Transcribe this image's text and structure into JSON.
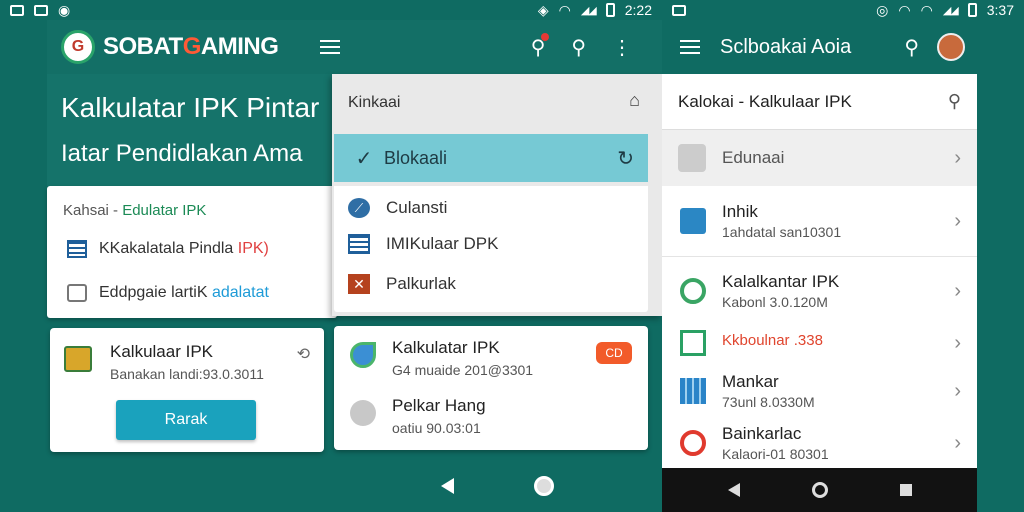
{
  "status_left": {
    "time": "2:22"
  },
  "status_right": {
    "time": "3:37"
  },
  "left_appbar": {
    "brand_prefix": "SOBAT",
    "brand_accent": "G",
    "brand_suffix": "AMING",
    "logo_glyph": "G"
  },
  "hero": {
    "title": "Kalkulatar IPK Pintar",
    "subtitle": "Iatar Pendidlakan Ama"
  },
  "left_card1": {
    "head_prefix": "Kahsai - ",
    "head_green": "Edulatar IPK",
    "row1_text": "KKakalatala Pindla ",
    "row1_red": "IPK)",
    "row2_text": "Eddpgaie lartiK ",
    "row2_blue": "adalatat"
  },
  "left_card2": {
    "title": "Kalkulaar IPK",
    "subtitle": "Banakan landi:93.0.3011",
    "button": "Rarak"
  },
  "mid_panel": {
    "header": "Kinkaai",
    "selected": "Blokaali",
    "items": [
      "Culansti",
      "IMIKulaar DPK",
      "Palkurlak"
    ]
  },
  "mid_card2": {
    "item1_title": "Kalkulatar IPK",
    "item1_sub": "G4 muaide 201@3301",
    "badge": "CD",
    "item2_title": "Pelkar Hang",
    "item2_sub": "oatiu 90.03:01"
  },
  "right_appbar": {
    "title": "Sclboakai Aoia"
  },
  "right_body": {
    "search_label": "Kalokai - Kalkulaar IPK",
    "edu_label": "Edunaai",
    "items": [
      {
        "title": "Inhik",
        "sub": "1ahdatal san10301"
      },
      {
        "title": "Kalalkantar IPK",
        "sub": "Kabonl 3.0.120M"
      },
      {
        "title": "Kkboulnar .338",
        "sub": ""
      },
      {
        "title": "Mankar",
        "sub": "73unl 8.0330M"
      },
      {
        "title": "Bainkarlac",
        "sub": "Kalaori-01 80301"
      }
    ]
  },
  "colors": {
    "teal_dark": "#0f6b62",
    "accent_cyan": "#1aa2bd",
    "selected_row": "#76c9d4",
    "brand_orange": "#ff5a36"
  },
  "icons": [
    "menu-icon",
    "search-icon",
    "more-icon",
    "pin-icon",
    "sync-icon",
    "share-icon",
    "chevron-right-icon",
    "avatar"
  ]
}
